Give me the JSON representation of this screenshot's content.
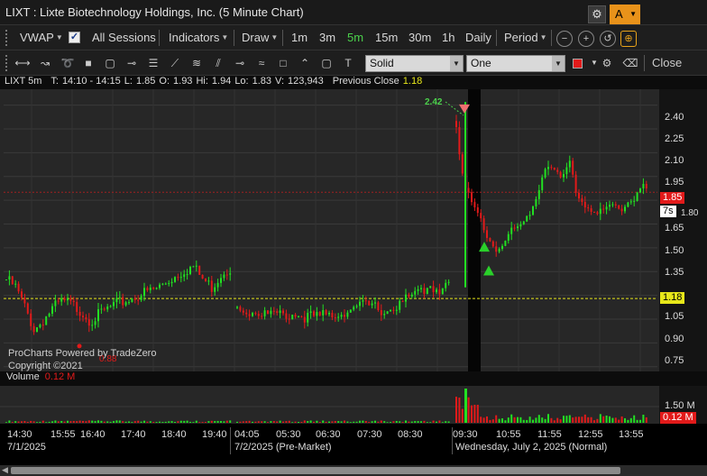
{
  "window": {
    "title": "LIXT : Lixte Biotechnology Holdings, Inc. (5 Minute Chart)",
    "settings_icon": "gear-icon",
    "alert_label": "A"
  },
  "toolbar": {
    "vwap_label": "VWAP",
    "all_sessions_label": "All Sessions",
    "all_sessions_checked": true,
    "indicators_label": "Indicators",
    "draw_label": "Draw",
    "intervals": [
      "1m",
      "3m",
      "5m",
      "15m",
      "30m",
      "1h",
      "Daily"
    ],
    "active_interval": "5m",
    "period_label": "Period",
    "icons": [
      "zoom-out-icon",
      "zoom-in-icon",
      "reset-zoom-icon",
      "crosshair-tool-icon"
    ]
  },
  "drawing_toolbar": {
    "tools": [
      "segment-tool-icon",
      "ray-tool-icon",
      "lasso-tool-icon",
      "rectangle-filled-icon",
      "rounded-rect-icon",
      "horizontal-line-icon",
      "parallel-lines-icon",
      "trendline-icon",
      "fibonacci-icon",
      "horizontal-ray-icon",
      "ribbon-icon",
      "rectangle-outline-icon",
      "polyline-icon",
      "ellipse-icon",
      "text-tool-icon"
    ],
    "line_style": "Solid",
    "line_width": "One",
    "color": "#e21a1a",
    "close_label": "Close"
  },
  "legend": {
    "symbol": "LIXT 5m",
    "T_label": "T:",
    "T": "14:10 - 14:15",
    "L_label": "L:",
    "L": "1.85",
    "O_label": "O:",
    "O": "1.93",
    "H_label": "Hi:",
    "H": "1.94",
    "Lo_label": "Lo:",
    "Lo": "1.83",
    "V_label": "V:",
    "V": "123,943",
    "prev_close_label": "Previous Close",
    "prev_close": "1.18"
  },
  "price_axis": {
    "ticks": [
      "2.40",
      "2.25",
      "2.10",
      "1.95",
      "1.80",
      "1.65",
      "1.50",
      "1.35",
      "1.20",
      "1.05",
      "0.90",
      "0.75"
    ],
    "last_price": "1.85",
    "countdown": "7s",
    "prev_close_tag": "1.18"
  },
  "annotations": {
    "high_label": "2.42",
    "low_label": "0.88"
  },
  "watermark": {
    "line1": "ProCharts Powered by TradeZero",
    "line2": "Copyright ©2021"
  },
  "volume": {
    "label": "Volume",
    "value": "0.12 M",
    "axis_max": "1.50 M",
    "axis_last": "0.12 M"
  },
  "time_axis": {
    "ticks": [
      "14:30",
      "15:55",
      "16:40",
      "17:40",
      "18:40",
      "19:40",
      "04:05",
      "05:30",
      "06:30",
      "07:30",
      "08:30",
      "09:30",
      "10:55",
      "11:55",
      "12:55",
      "13:55"
    ],
    "dates": [
      "7/1/2025",
      "7/2/2025 (Pre-Market)",
      "Wednesday, July 2, 2025 (Normal)"
    ]
  },
  "chart_data": {
    "type": "candlestick",
    "symbol": "LIXT",
    "interval": "5m",
    "ylim": [
      0.72,
      2.5
    ],
    "prev_close": 1.18,
    "last": 1.85,
    "session_high": 2.42,
    "session_low": 0.88,
    "up_color": "#22e022",
    "down_color": "#e21a1a",
    "prev_close_color": "#e7e71a",
    "grid": true,
    "segments": [
      {
        "session": "7/1/2025 after-hours",
        "close_path": [
          1.3,
          1.25,
          1.12,
          0.98,
          1.05,
          1.12,
          1.16,
          1.14,
          1.1,
          1.04,
          1.08,
          1.12,
          1.15,
          1.17,
          1.2,
          1.22,
          1.24,
          1.28,
          1.32,
          1.36,
          1.38,
          1.3,
          1.25,
          1.34,
          1.38
        ]
      },
      {
        "session": "7/2/2025 pre-market",
        "close_path": [
          1.12,
          1.1,
          1.09,
          1.08,
          1.07,
          1.08,
          1.07,
          1.06,
          1.07,
          1.08,
          1.1,
          1.12,
          1.14,
          1.12,
          1.1,
          1.14,
          1.18,
          1.22,
          1.26,
          1.24,
          1.28
        ]
      },
      {
        "session": "7/2/2025 regular",
        "close_path": [
          2.3,
          1.9,
          1.78,
          1.7,
          1.62,
          1.52,
          1.5,
          1.55,
          1.6,
          1.62,
          1.7,
          1.78,
          1.95,
          2.05,
          1.98,
          1.92,
          2.02,
          1.85,
          1.8,
          1.75,
          1.7,
          1.72,
          1.76,
          1.74,
          1.78,
          1.82,
          1.88,
          1.85
        ]
      }
    ],
    "signals": [
      {
        "type": "sell",
        "price": 2.37
      },
      {
        "type": "buy",
        "price": 1.51
      },
      {
        "type": "buy",
        "price": 1.36
      }
    ]
  }
}
